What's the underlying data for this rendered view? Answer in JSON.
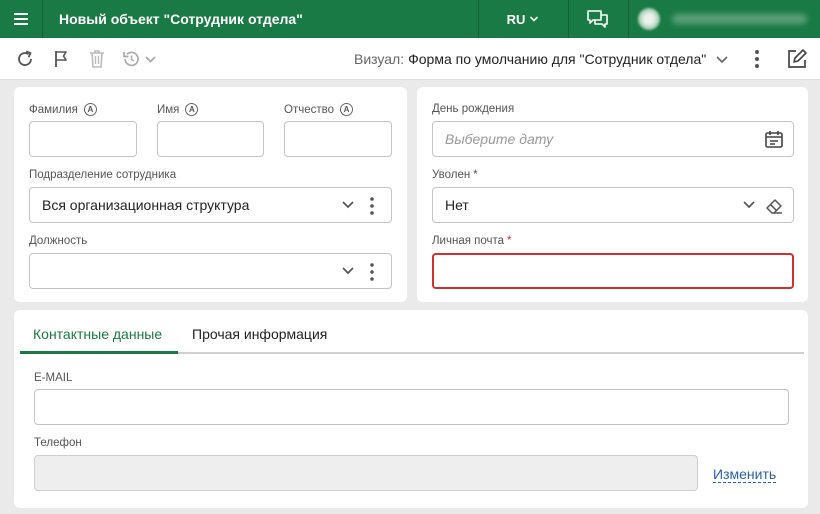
{
  "header": {
    "title": "Новый объект \"Сотрудник отдела\"",
    "lang": "RU",
    "icons": [
      "menu-icon",
      "chevron-down-icon",
      "chat-icon"
    ]
  },
  "toolbar": {
    "visual_label": "Визуал:",
    "visual_value": "Форма по умолчанию для \"Сотрудник отдела\"",
    "icons": [
      "refresh-icon",
      "flag-icon",
      "trash-icon",
      "history-icon",
      "more-vertical-icon",
      "edit-icon"
    ]
  },
  "form": {
    "last_name_label": "Фамилия",
    "first_name_label": "Имя",
    "middle_name_label": "Отчество",
    "department_label": "Подразделение сотрудника",
    "department_value": "Вся организационная структура",
    "position_label": "Должность",
    "position_value": "",
    "birthday_label": "День рождения",
    "birthday_placeholder": "Выберите дату",
    "fired_label": "Уволен",
    "fired_value": "Нет",
    "email_personal_label": "Личная почта",
    "required_mark": "*"
  },
  "tabs": [
    {
      "label": "Контактные данные",
      "active": true
    },
    {
      "label": "Прочая информация",
      "active": false
    }
  ],
  "contacts": {
    "email_label": "E-MAIL",
    "phone_label": "Телефон",
    "change_link": "Изменить"
  },
  "colors": {
    "brand": "#1a7a45",
    "error": "#d32f2f",
    "link": "#2a5ea8"
  }
}
